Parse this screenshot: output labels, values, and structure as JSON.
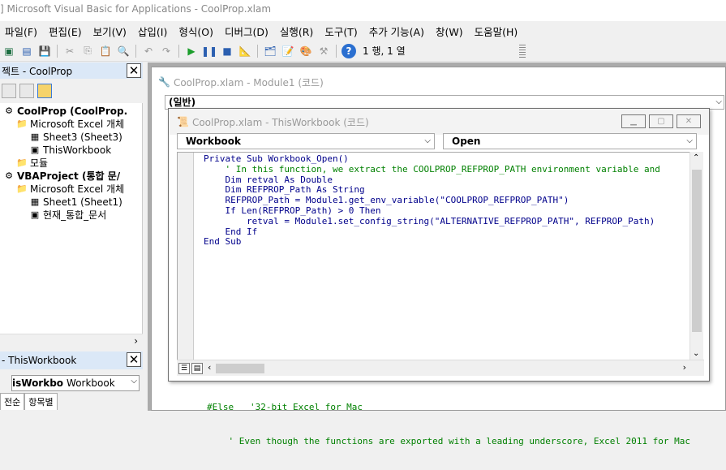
{
  "app": {
    "title": "] Microsoft Visual Basic for Applications - CoolProp.xlam"
  },
  "menu": {
    "items": [
      "파일(F)",
      "편집(E)",
      "보기(V)",
      "삽입(I)",
      "형식(O)",
      "디버그(D)",
      "실행(R)",
      "도구(T)",
      "추가 기능(A)",
      "창(W)",
      "도움말(H)"
    ]
  },
  "toolbar": {
    "position": "1 행, 1 열"
  },
  "project_pane": {
    "title": "젝트 - CoolProp",
    "tree": [
      {
        "label": "CoolProp (CoolProp.",
        "bold": true,
        "indent": 0,
        "icon": "vba-project-icon"
      },
      {
        "label": "Microsoft Excel 개체",
        "bold": false,
        "indent": 1,
        "icon": "folder-icon"
      },
      {
        "label": "Sheet3 (Sheet3)",
        "bold": false,
        "indent": 2,
        "icon": "sheet-icon"
      },
      {
        "label": "ThisWorkbook",
        "bold": false,
        "indent": 2,
        "icon": "workbook-icon"
      },
      {
        "label": "모듈",
        "bold": false,
        "indent": 1,
        "icon": "folder-icon"
      },
      {
        "label": "VBAProject (통합 문/",
        "bold": true,
        "indent": 0,
        "icon": "vba-project-icon"
      },
      {
        "label": "Microsoft Excel 개체",
        "bold": false,
        "indent": 1,
        "icon": "folder-icon"
      },
      {
        "label": "Sheet1 (Sheet1)",
        "bold": false,
        "indent": 2,
        "icon": "sheet-icon"
      },
      {
        "label": "현재_통합_문서",
        "bold": false,
        "indent": 2,
        "icon": "workbook-icon"
      }
    ]
  },
  "properties_pane": {
    "title": "- ThisWorkbook",
    "object_name": "isWorkbo",
    "object_type": "Workbook",
    "tabs": [
      "전순",
      "항목별"
    ]
  },
  "module1_window": {
    "title": "CoolProp.xlam - Module1 (코드)",
    "combo_value": "(일반)",
    "code_lines": [
      "#Else   '32-bit Excel for Mac",
      "    ' Even though the functions are exported with a leading underscore, Excel 2011 for Mac"
    ]
  },
  "workbook_window": {
    "title": "CoolProp.xlam - ThisWorkbook (코드)",
    "object_combo": "Workbook",
    "proc_combo": "Open",
    "code_lines": [
      {
        "text": "Private Sub Workbook_Open()",
        "kind": "kw"
      },
      {
        "text": "    ' In this function, we extract the COOLPROP_REFPROP_PATH environment variable and",
        "kind": "cm"
      },
      {
        "text": "    Dim retval As Double",
        "kind": "kw"
      },
      {
        "text": "    Dim REFPROP_Path As String",
        "kind": "kw"
      },
      {
        "text": "    REFPROP_Path = Module1.get_env_variable(\"COOLPROP_REFPROP_PATH\")",
        "kind": "kw"
      },
      {
        "text": "    If Len(REFPROP_Path) > 0 Then",
        "kind": "kw"
      },
      {
        "text": "        retval = Module1.set_config_string(\"ALTERNATIVE_REFPROP_PATH\", REFPROP_Path)",
        "kind": "kw"
      },
      {
        "text": "    End If",
        "kind": "kw"
      },
      {
        "text": "End Sub",
        "kind": "kw"
      }
    ]
  }
}
